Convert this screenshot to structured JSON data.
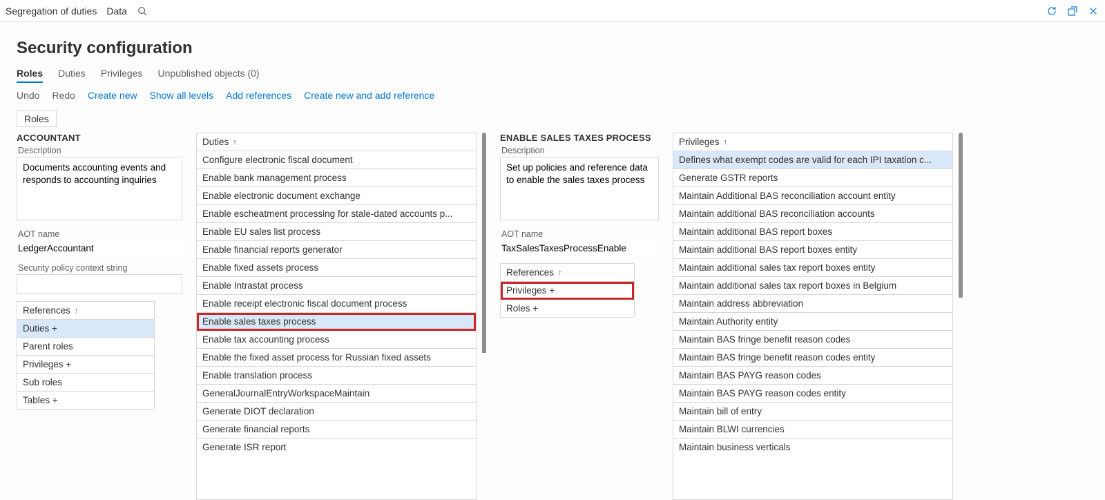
{
  "breadcrumb": {
    "level1": "Segregation of duties",
    "level2": "Data"
  },
  "titleBarIcons": {
    "refresh": "refresh-icon",
    "popout": "popout-icon",
    "close": "close-icon"
  },
  "page_title": "Security configuration",
  "tabs": [
    {
      "label": "Roles",
      "active": true
    },
    {
      "label": "Duties",
      "active": false
    },
    {
      "label": "Privileges",
      "active": false
    },
    {
      "label": "Unpublished objects (0)",
      "active": false
    }
  ],
  "actions": [
    {
      "label": "Undo",
      "enabled": false
    },
    {
      "label": "Redo",
      "enabled": false
    },
    {
      "label": "Create new",
      "enabled": true
    },
    {
      "label": "Show all levels",
      "enabled": true
    },
    {
      "label": "Add references",
      "enabled": true
    },
    {
      "label": "Create new and add reference",
      "enabled": true
    }
  ],
  "roles_chip": "Roles",
  "role_panel": {
    "heading": "ACCOUNTANT",
    "description_label": "Description",
    "description": "Documents accounting events and responds to accounting inquiries",
    "aot_label": "AOT name",
    "aot_name": "LedgerAccountant",
    "policy_label": "Security policy context string",
    "policy_value": "",
    "references_header": "References",
    "references": [
      {
        "label": "Duties +",
        "selected": true
      },
      {
        "label": "Parent roles",
        "selected": false
      },
      {
        "label": "Privileges +",
        "selected": false
      },
      {
        "label": "Sub roles",
        "selected": false
      },
      {
        "label": "Tables +",
        "selected": false
      }
    ]
  },
  "duties_panel": {
    "header": "Duties",
    "rows": [
      {
        "label": "Configure electronic fiscal document"
      },
      {
        "label": "Enable bank management process"
      },
      {
        "label": "Enable electronic document exchange"
      },
      {
        "label": "Enable escheatment processing for stale-dated accounts p..."
      },
      {
        "label": "Enable EU sales list process"
      },
      {
        "label": "Enable financial reports generator"
      },
      {
        "label": "Enable fixed assets process"
      },
      {
        "label": "Enable Intrastat process"
      },
      {
        "label": "Enable receipt electronic fiscal document process"
      },
      {
        "label": "Enable sales taxes process",
        "selected": true,
        "redOutline": true
      },
      {
        "label": "Enable tax accounting process"
      },
      {
        "label": "Enable the fixed asset process for Russian fixed assets"
      },
      {
        "label": "Enable translation process"
      },
      {
        "label": "GeneralJournalEntryWorkspaceMaintain"
      },
      {
        "label": "Generate DIOT declaration"
      },
      {
        "label": "Generate financial reports"
      },
      {
        "label": "Generate ISR report"
      }
    ]
  },
  "duty_panel": {
    "heading": "ENABLE SALES TAXES PROCESS",
    "description_label": "Description",
    "description": "Set up policies and reference data to enable the sales taxes process",
    "aot_label": "AOT name",
    "aot_name": "TaxSalesTaxesProcessEnable",
    "references_header": "References",
    "references": [
      {
        "label": "Privileges +",
        "redOutline": true
      },
      {
        "label": "Roles +"
      }
    ]
  },
  "privileges_panel": {
    "header": "Privileges",
    "rows": [
      {
        "label": "Defines what exempt codes are valid for each IPI taxation c...",
        "selected": true
      },
      {
        "label": "Generate GSTR reports"
      },
      {
        "label": "Maintain Additional BAS reconciliation account entity"
      },
      {
        "label": "Maintain additional BAS reconciliation accounts"
      },
      {
        "label": "Maintain additional BAS report boxes"
      },
      {
        "label": "Maintain additional BAS report boxes entity"
      },
      {
        "label": "Maintain additional sales tax report boxes entity"
      },
      {
        "label": "Maintain additional sales tax report boxes in Belgium"
      },
      {
        "label": "Maintain address abbreviation"
      },
      {
        "label": "Maintain Authority entity"
      },
      {
        "label": "Maintain BAS fringe benefit reason codes"
      },
      {
        "label": "Maintain BAS fringe benefit reason codes entity"
      },
      {
        "label": "Maintain BAS PAYG reason codes"
      },
      {
        "label": "Maintain BAS PAYG reason codes entity"
      },
      {
        "label": "Maintain bill of entry"
      },
      {
        "label": "Maintain BLWI currencies"
      },
      {
        "label": "Maintain business verticals"
      }
    ]
  }
}
